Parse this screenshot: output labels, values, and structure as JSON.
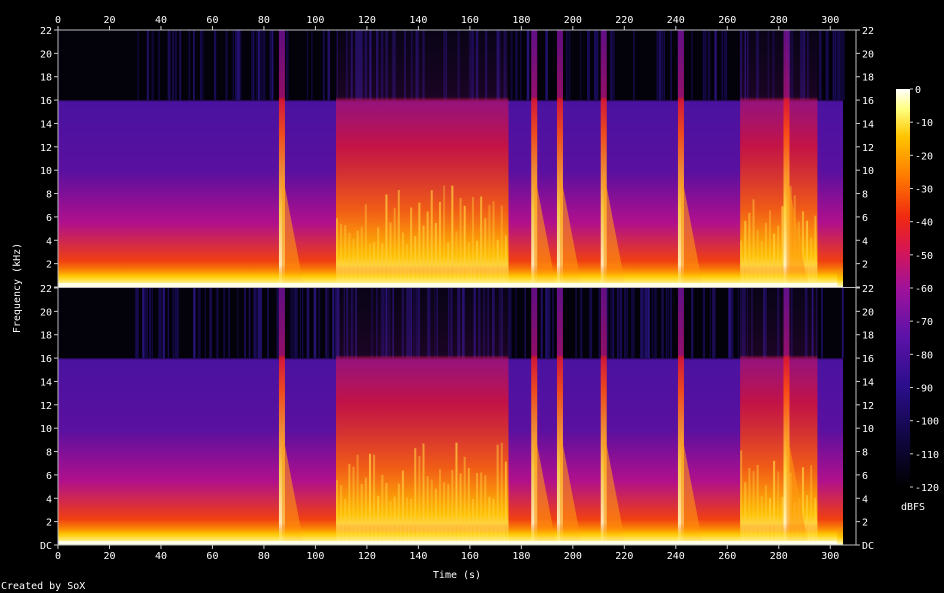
{
  "chart_data": {
    "type": "heatmap",
    "subtype": "spectrogram",
    "channels": 2,
    "xlabel": "Time (s)",
    "ylabel": "Frequency (kHz)",
    "x_ticks": [
      "0",
      "20",
      "40",
      "60",
      "80",
      "100",
      "120",
      "140",
      "160",
      "180",
      "200",
      "220",
      "240",
      "260",
      "280",
      "300"
    ],
    "x_range": [
      0,
      310
    ],
    "y_ticks": [
      "DC",
      "2",
      "4",
      "6",
      "8",
      "10",
      "12",
      "14",
      "16",
      "18",
      "20",
      "22"
    ],
    "y_range": [
      0,
      22
    ],
    "colorbar": {
      "label": "dBFS",
      "ticks": [
        "0",
        "-10",
        "-20",
        "-30",
        "-40",
        "-50",
        "-60",
        "-70",
        "-80",
        "-90",
        "-100",
        "-110",
        "-120"
      ],
      "range": [
        -120,
        0
      ]
    },
    "content_band_limit_khz": 16,
    "audio_end_s": 305,
    "transient_peaks_s": [
      87,
      185,
      195,
      212,
      242,
      283
    ],
    "loud_regions_s": [
      [
        108,
        175
      ],
      [
        265,
        295
      ]
    ],
    "footer": "Created by SoX",
    "colors": {
      "background": "#000000",
      "text": "#ffffff",
      "axis": "#cccccc",
      "palette": [
        "#000000",
        "#1a0a5c",
        "#5a10a0",
        "#b0108c",
        "#e81428",
        "#ff7a00",
        "#ffd000",
        "#ffffd0",
        "#ffffff"
      ]
    }
  }
}
